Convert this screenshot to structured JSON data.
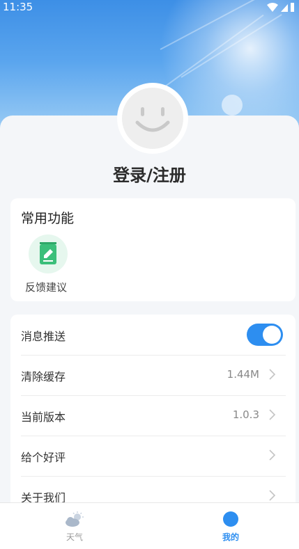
{
  "status_bar": {
    "time": "11:35"
  },
  "profile": {
    "login_label": "登录/注册"
  },
  "common_functions": {
    "title": "常用功能",
    "items": [
      {
        "label": "反馈建议",
        "icon": "feedback-edit-icon"
      }
    ]
  },
  "settings": {
    "rows": [
      {
        "label": "消息推送",
        "toggle_on": true
      },
      {
        "label": "清除缓存",
        "value": "1.44M"
      },
      {
        "label": "当前版本",
        "value": "1.0.3"
      },
      {
        "label": "给个好评"
      },
      {
        "label": "关于我们"
      }
    ]
  },
  "tabbar": {
    "tabs": [
      {
        "label": "天气",
        "icon": "weather-icon",
        "active": false
      },
      {
        "label": "我的",
        "icon": "profile-dot-icon",
        "active": true
      }
    ]
  },
  "colors": {
    "accent": "#2d8ef0",
    "feedback_green": "#3bbf7a"
  }
}
